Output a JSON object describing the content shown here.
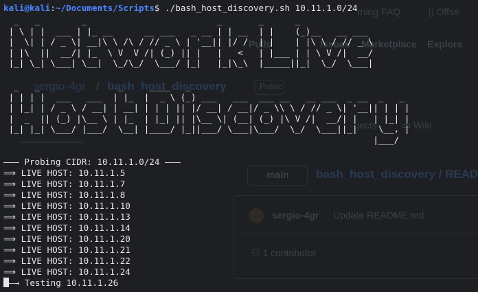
{
  "prompt": {
    "user_host": "kali@kali",
    "separator": ":",
    "path": "~/Documents/Scripts",
    "symbol": "$",
    "command": " ./bash_host_discovery.sh 10.11.1.0/24"
  },
  "banner": {
    "line1": "  _   _        _                         _       _      _              \n | \\ | |  ___ | |_ __      __ ___   _ __ | | __  | |    (_)__   __ ___  \n |  \\| | / _ \\| __|\\ \\ /\\ / // _ \\ | '__|| |/ /  | |    | |\\ \\ / // _ \\ \n | |\\  ||  __/| |_  \\ V  V /| (_) || |   |   <   | |___ | | \\ V /|  __/ \n |_| \\_| \\___| \\__|  \\_/\\_/  \\___/ |_|   |_|\\_\\  |_____||_|  \\_/  \\___| ",
    "line2": "  _   _               _     ____   _                                         \n | | | |  ___   ___  | |_  |  _ \\ (_) ___   ___  ___ __   __ ___  _ __  _   _ \n | |_| | / _ \\ / __| | __| | | | || |/ __| / __|/ _ \\\\ \\ / // _ \\| '__|| | | |\n |  _  || (_) |\\__ \\ | |_  | |_| || |\\__ \\| (__| (_) |\\ V /|  __/| |   | |_| |\n |_| |_| \\___/ |___/  \\__| |____/ |_||___/ \\___|\\___/  \\_/  \\___||_|    \\__, |\n                                                                       |___/ "
  },
  "output": {
    "probing": "——— Probing CIDR: 10.11.1.0/24 ———",
    "live_prefix": "⟹ LIVE HOST: ",
    "hosts": [
      "10.11.1.5",
      "10.11.1.7",
      "10.11.1.8",
      "10.11.1.10",
      "10.11.1.13",
      "10.11.1.14",
      "10.11.1.20",
      "10.11.1.21",
      "10.11.1.22",
      "10.11.1.24"
    ],
    "testing_arrow": "—→ ",
    "testing": "Testing 10.11.1.26"
  },
  "background": {
    "learning_faq": "rning FAQ",
    "offset": "Offse",
    "pulls": "Pulls",
    "issues": "Issues",
    "marketplace": "Marketplace",
    "explore": "Explore",
    "repo_owner": "sergio-4gr",
    "repo_sep": "/",
    "repo_name": "bash_host_discovery",
    "visibility": "Public",
    "projects": "jects",
    "wiki": "Wiki",
    "branch": "main",
    "file_path": "bash_host_discovery / READM",
    "commit_user": "sergio-4gr",
    "commit_msg": "Update README.md",
    "contributors": "1 contributor"
  }
}
